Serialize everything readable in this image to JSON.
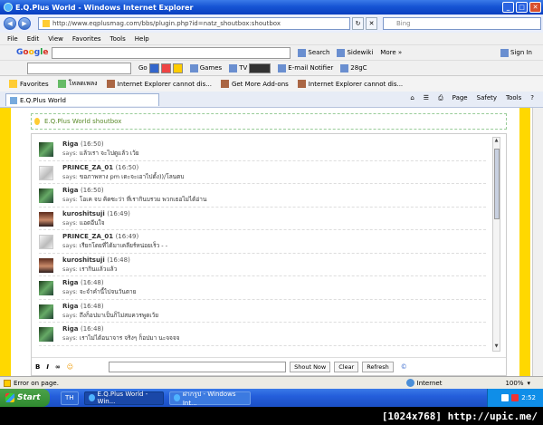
{
  "window": {
    "title": "E.Q.Plus World - Windows Internet Explorer"
  },
  "address": {
    "url": "http://www.eqplusmag.com/bbs/plugin.php?id=natz_shoutbox:shoutbox"
  },
  "search": {
    "placeholder": "Bing"
  },
  "menu": {
    "items": [
      "File",
      "Edit",
      "View",
      "Favorites",
      "Tools",
      "Help"
    ]
  },
  "googlebar": {
    "logo": [
      "G",
      "o",
      "o",
      "g",
      "l",
      "e"
    ],
    "search_label": "Search",
    "sidewiki_label": "Sidewiki",
    "more_label": "More »",
    "signin_label": "Sign In"
  },
  "toolbar2": {
    "go_label": "Go",
    "games_label": "Games",
    "tv_label": "TV",
    "email_label": "E-mail Notifier",
    "temp_label": "28gC"
  },
  "favorites": {
    "label": "Favorites",
    "items": [
      "โหลดเพลง",
      "Internet Explorer cannot dis...",
      "Get More Add-ons",
      "Internet Explorer cannot dis..."
    ]
  },
  "tab": {
    "label": "E.Q.Plus World"
  },
  "commands": {
    "page": "Page",
    "safety": "Safety",
    "tools": "Tools"
  },
  "shoutbox": {
    "title": "E.Q.Plus World shoutbox",
    "says_label": "says:",
    "messages": [
      {
        "user": "Riga",
        "time": "(16:50)",
        "text": "แล้วเรา จะไปดูแล้ว เว้ย"
      },
      {
        "user": "PRINCE_ZA_01",
        "time": "(16:50)",
        "text": "ขอภาพหาง pm เดะจะเอาไปตั้ง))/โลนตบ"
      },
      {
        "user": "Riga",
        "time": "(16:50)",
        "text": "โอเค จบ คิดซะว่า ที่เรากินบรวม พวกเธอไม่ได้อ่าน"
      },
      {
        "user": "kuroshitsuji",
        "time": "(16:49)",
        "text": "แอดอีนใจ"
      },
      {
        "user": "PRINCE_ZA_01",
        "time": "(16:49)",
        "text": "เรียกโดยที่ได้มาเคลียร์หน่อยเร็ว - -"
      },
      {
        "user": "kuroshitsuji",
        "time": "(16:48)",
        "text": "เรากินแล้วแล้ว"
      },
      {
        "user": "Riga",
        "time": "(16:48)",
        "text": "จะจำคำนี้ไปจนวันตาย"
      },
      {
        "user": "Riga",
        "time": "(16:48)",
        "text": "ถึงก็อปมาเป็นก็ไม่สมควรพูดเว้ย"
      },
      {
        "user": "Riga",
        "time": "(16:48)",
        "text": "เราไม่ได้อนาจาร จริงๆ ก็อปมา นะจจจจ"
      }
    ],
    "format_buttons": [
      "B",
      "I",
      "∞"
    ],
    "shout_label": "Shout Now",
    "clear_label": "Clear",
    "refresh_label": "Refresh",
    "copyright": "©"
  },
  "status": {
    "text": "Error on page.",
    "zone": "Internet",
    "zoom": "100%"
  },
  "taskbar": {
    "start": "Start",
    "lang": "TH",
    "task1": "E.Q.Plus World - Win...",
    "task2": "ฝากรูป - Windows Int...",
    "clock": "2:52"
  },
  "watermark": {
    "text": "[1024x768] http://upic.me/"
  }
}
